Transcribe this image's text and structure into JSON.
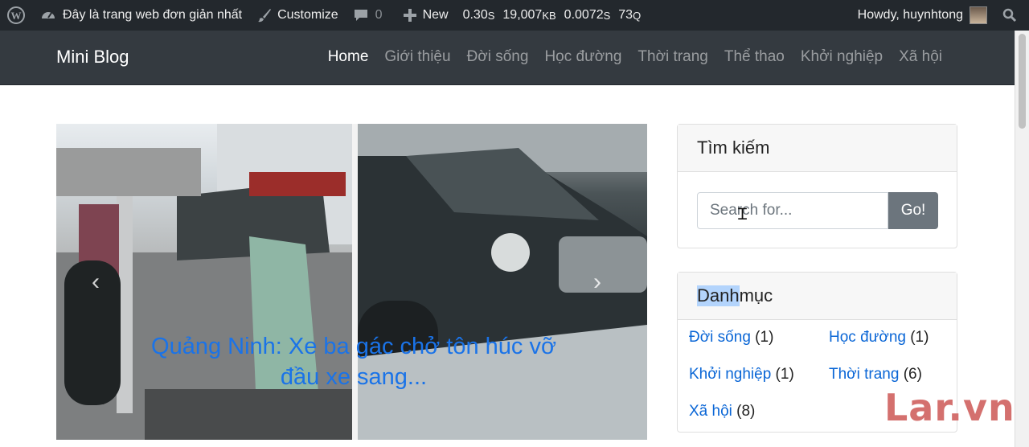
{
  "adminbar": {
    "site_name": "Đây là trang web đơn giản nhất",
    "customize": "Customize",
    "comments": "0",
    "new": "New",
    "qm_time": "0.30",
    "qm_time_unit": "S",
    "qm_mem": "19,007",
    "qm_mem_unit": "KB",
    "qm_query_time": "0.0072",
    "qm_query_time_unit": "S",
    "qm_queries": "73",
    "qm_queries_unit": "Q",
    "howdy": "Howdy, huynhtong"
  },
  "navbar": {
    "brand": "Mini Blog",
    "items": [
      {
        "label": "Home",
        "active": true
      },
      {
        "label": "Giới thiệu"
      },
      {
        "label": "Đời sống"
      },
      {
        "label": "Học đường"
      },
      {
        "label": "Thời trang"
      },
      {
        "label": "Thể thao"
      },
      {
        "label": "Khởi nghiệp"
      },
      {
        "label": "Xã hội"
      }
    ]
  },
  "carousel": {
    "caption": "Quảng Ninh: Xe ba gác chở tôn húc vỡ đầu xe sang..."
  },
  "search": {
    "title": "Tìm kiếm",
    "placeholder": "Search for...",
    "button": "Go!"
  },
  "categories": {
    "title_highlight": "Danh",
    "title_rest": " mục",
    "items": [
      {
        "label": "Đời sống",
        "count": "(1)"
      },
      {
        "label": "Học đường",
        "count": "(1)"
      },
      {
        "label": "Khởi nghiệp",
        "count": "(1)"
      },
      {
        "label": "Thời trang",
        "count": "(6)"
      },
      {
        "label": "Xã hội",
        "count": "(8)"
      }
    ]
  },
  "watermark": "Lar.vn"
}
